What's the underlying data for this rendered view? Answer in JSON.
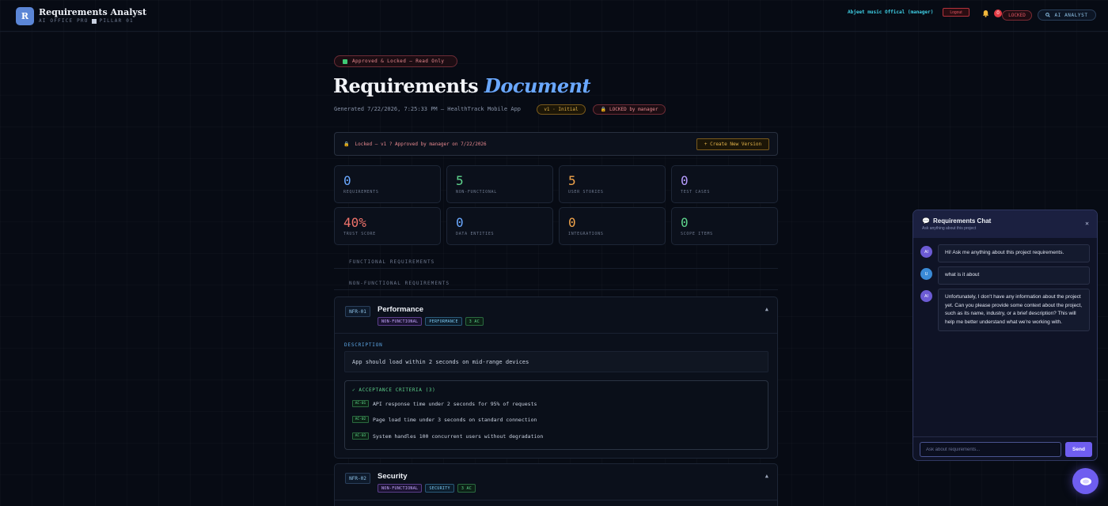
{
  "header": {
    "logo_letter": "R",
    "app_title": "Requirements Analyst",
    "subtitle_left": "AI OFFICE PRO",
    "subtitle_right": "PILLAR 01",
    "user_name": "Abjeet music Offical (manager)",
    "logout_label": "Logout",
    "notification_count": "0",
    "locked_label": "LOCKED",
    "ai_analyst_label": "AI ANALYST"
  },
  "document": {
    "status_pill": "Approved & Locked — Read Only",
    "title_main": "Requirements",
    "title_accent": "Document",
    "meta": "Generated 7/22/2026, 7:25:33 PM — HealthTrack Mobile App",
    "version_pill": "v1 · Initial",
    "locked_by_pill": "LOCKED by manager",
    "lock_banner": "Locked — v1 ? Approved by manager on 7/22/2026",
    "create_version_label": "+ Create New Version"
  },
  "stats": [
    {
      "value": "0",
      "label": "REQUIREMENTS",
      "color": "#6aa8ff"
    },
    {
      "value": "5",
      "label": "NON-FUNCTIONAL",
      "color": "#5ed48c"
    },
    {
      "value": "5",
      "label": "USER STORIES",
      "color": "#f0a34a"
    },
    {
      "value": "0",
      "label": "TEST CASES",
      "color": "#b79cff"
    },
    {
      "value": "40%",
      "label": "TRUST SCORE",
      "color": "#f0736b"
    },
    {
      "value": "0",
      "label": "DATA ENTITIES",
      "color": "#6aa8ff"
    },
    {
      "value": "0",
      "label": "INTEGRATIONS",
      "color": "#f0a34a"
    },
    {
      "value": "0",
      "label": "SCOPE ITEMS",
      "color": "#5ed48c"
    }
  ],
  "sections": {
    "functional": "FUNCTIONAL REQUIREMENTS",
    "non_functional": "NON-FUNCTIONAL REQUIREMENTS"
  },
  "requirements": [
    {
      "id": "NFR-01",
      "title": "Performance",
      "tag_type": "NON-FUNCTIONAL",
      "tag_category": "PERFORMANCE",
      "tag_ac": "3 AC",
      "description_label": "DESCRIPTION",
      "description": "App should load within 2 seconds on mid-range devices",
      "ac_header": "✓ ACCEPTANCE CRITERIA (3)",
      "criteria": [
        {
          "id": "AC-01",
          "text": "API response time under 2 seconds for 95% of requests"
        },
        {
          "id": "AC-02",
          "text": "Page load time under 3 seconds on standard connection"
        },
        {
          "id": "AC-03",
          "text": "System handles 100 concurrent users without degradation"
        }
      ]
    },
    {
      "id": "NFR-02",
      "title": "Security",
      "tag_type": "NON-FUNCTIONAL",
      "tag_category": "SECURITY",
      "tag_ac": "3 AC"
    }
  ],
  "chat": {
    "title": "Requirements Chat",
    "subtitle": "Ask anything about this project",
    "messages": [
      {
        "role": "AI",
        "text": "Hi! Ask me anything about this project requirements."
      },
      {
        "role": "U",
        "text": "what is it about"
      },
      {
        "role": "AI",
        "text": "Unfortunately, I don't have any information about the project yet. Can you please provide some context about the project, such as its name, industry, or a brief description? This will help me better understand what we're working with."
      }
    ],
    "input_placeholder": "Ask about requirements...",
    "send_label": "Send"
  }
}
